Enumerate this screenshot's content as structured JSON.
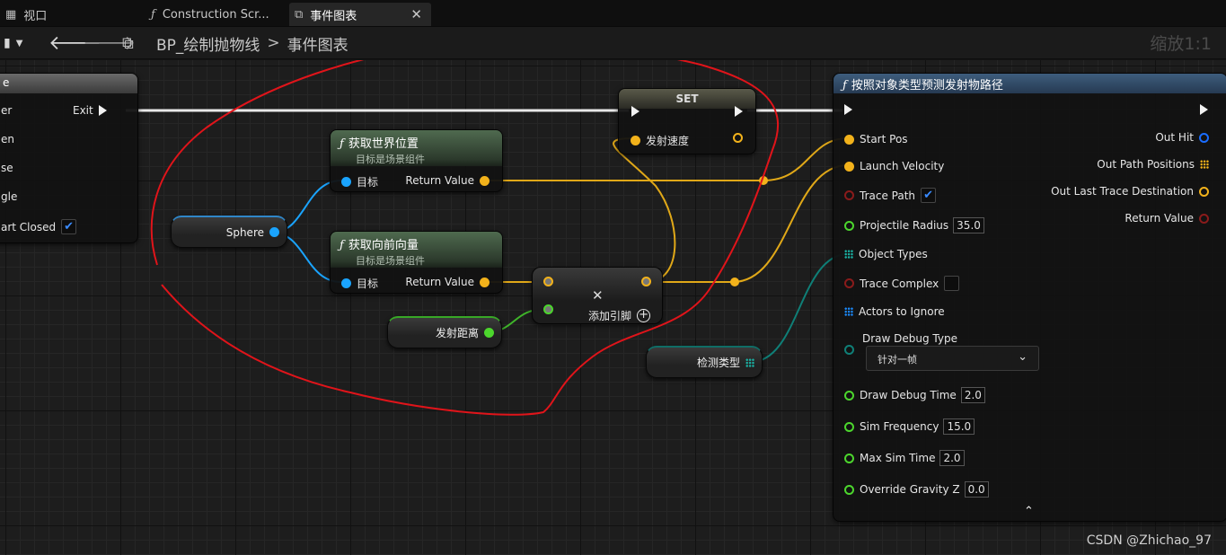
{
  "tabs": [
    {
      "label": "视口",
      "icon": "viewport-icon"
    },
    {
      "label": "Construction Scr...",
      "icon": "function-icon"
    },
    {
      "label": "事件图表",
      "icon": "event-graph-icon",
      "active": true
    }
  ],
  "toolbar": {
    "breadcrumb": {
      "blueprint": "BP_绘制抛物线",
      "separator": ">",
      "graph": "事件图表"
    },
    "zoom": "缩放1:1"
  },
  "left_node": {
    "title": "e",
    "exec_out": "Exit",
    "pins": [
      "er",
      "en",
      "se",
      "gle",
      "art Closed"
    ],
    "start_closed_checked": true
  },
  "set_node": {
    "title": "SET",
    "pin": "发射速度"
  },
  "get_world_location": {
    "title": "获取世界位置",
    "subtitle": "目标是场景组件",
    "target": "目标",
    "return": "Return Value"
  },
  "get_forward_vector": {
    "title": "获取向前向量",
    "subtitle": "目标是场景组件",
    "target": "目标",
    "return": "Return Value"
  },
  "sphere_var": "Sphere",
  "launch_distance_var": "发射距离",
  "multiply_node": {
    "add_pin": "添加引脚",
    "symbol": "✕"
  },
  "detect_type_var": "检测类型",
  "predict_node": {
    "title": "按照对象类型预测发射物路径",
    "inputs": {
      "start_pos": "Start Pos",
      "launch_velocity": "Launch Velocity",
      "trace_path": "Trace Path",
      "projectile_radius": "Projectile Radius",
      "projectile_radius_value": "35.0",
      "object_types": "Object Types",
      "trace_complex": "Trace Complex",
      "actors_to_ignore": "Actors to Ignore",
      "draw_debug_type": "Draw Debug Type",
      "draw_debug_type_value": "针对一帧",
      "draw_debug_time": "Draw Debug Time",
      "draw_debug_time_value": "2.0",
      "sim_frequency": "Sim Frequency",
      "sim_frequency_value": "15.0",
      "max_sim_time": "Max Sim Time",
      "max_sim_time_value": "2.0",
      "override_gravity_z": "Override Gravity Z",
      "override_gravity_z_value": "0.0"
    },
    "outputs": {
      "out_hit": "Out Hit",
      "out_path_positions": "Out Path Positions",
      "out_last_trace_destination": "Out Last Trace Destination",
      "return_value": "Return Value"
    },
    "trace_path_checked": true,
    "trace_complex_checked": false
  },
  "watermark": "CSDN @Zhichao_97",
  "colors": {
    "vector_pin": "#f2b21b",
    "object_pin": "#1aa4ff",
    "float_pin": "#4cd62d",
    "bool_pin": "#8a1b1b",
    "annotation": "#e0141a"
  }
}
